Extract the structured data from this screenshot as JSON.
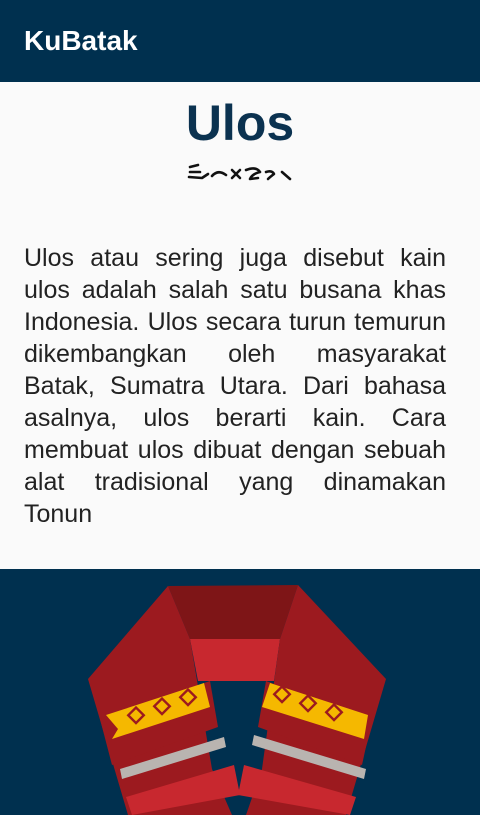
{
  "app_bar": {
    "title": "KuBatak"
  },
  "article": {
    "title": "Ulos",
    "script_caption_icon": "batak-script-glyphs",
    "body": "Ulos atau  sering juga disebut kain ulos adalah salah  satu busana khas Indonesia. Ulos secara turun temurun dikembangkan oleh masyarakat Batak, Sumatra Utara. Dari bahasa  asalnya, ulos berarti kain. Cara membuat ulos  dibuat dengan sebuah  alat tradisional yang dinamakan Tonun"
  },
  "illustration": {
    "icon": "ulos-scarf-illustration",
    "colors": {
      "background": "#00304f",
      "cloth": "#9c1a1f",
      "cloth_dark": "#7e1517",
      "cloth_light": "#c8282f",
      "stripe_yellow": "#f5b800",
      "stripe_grey": "#b9b4b0"
    }
  },
  "theme": {
    "primary": "#00304f",
    "heading": "#0b3250",
    "background": "#fafafa"
  }
}
